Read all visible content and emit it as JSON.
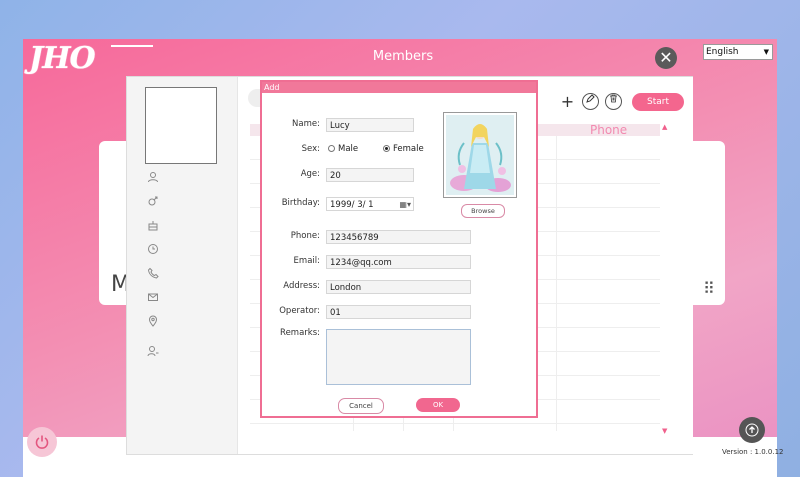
{
  "window": {
    "title": "Members",
    "logo_text": "JHO",
    "close_glyph": "✕",
    "language": {
      "selected": "English"
    },
    "version": "Version : 1.0.0.12",
    "card_left_letter": "M",
    "card_right_dots": "⠿"
  },
  "toolbar": {
    "start_label": "Start",
    "add_icon": "+",
    "edit_icon": "✎",
    "delete_icon": "🗑"
  },
  "table": {
    "visible_header": "Phone"
  },
  "sidebar_icons": [
    "user-icon",
    "gender-icon",
    "cake-icon",
    "clock-icon",
    "phone-icon",
    "mail-icon",
    "location-icon",
    "operator-icon"
  ],
  "dialog": {
    "title": "Add",
    "labels": {
      "name": "Name:",
      "sex": "Sex:",
      "age": "Age:",
      "birthday": "Birthday:",
      "phone": "Phone:",
      "email": "Email:",
      "address": "Address:",
      "operator": "Operator:",
      "remarks": "Remarks:"
    },
    "values": {
      "name": "Lucy",
      "age": "20",
      "birthday": "1999/  3/  1",
      "phone": "123456789",
      "email": "1234@qq.com",
      "address": "London",
      "operator": "01",
      "remarks": ""
    },
    "sex_options": {
      "male": "Male",
      "female": "Female",
      "selected": "Female"
    },
    "browse_label": "Browse",
    "cancel_label": "Cancel",
    "ok_label": "OK"
  },
  "colors": {
    "accent": "#f1678f",
    "titlebar": "#f1789a",
    "close_button": "#5a5a5a"
  }
}
